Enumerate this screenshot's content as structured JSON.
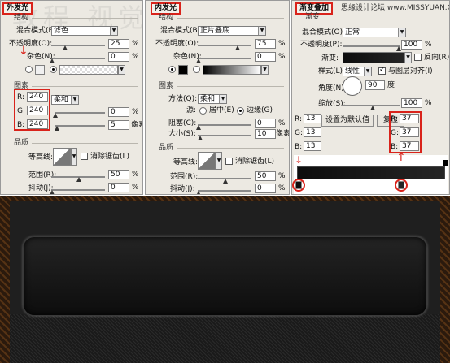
{
  "outer_glow": {
    "title": "外发光",
    "structure": "结构",
    "blend_mode_label": "混合模式(E):",
    "blend_mode": "滤色",
    "opacity_label": "不透明度(O):",
    "opacity": "25",
    "noise_label": "杂色(N):",
    "noise": "0",
    "pct": "%",
    "elements": "图素",
    "technique": "柔和",
    "r_label": "R:",
    "r": "240",
    "g_label": "G:",
    "g": "240",
    "b_label": "B:",
    "b": "240",
    "spread": "0",
    "size": "5",
    "px": "像素",
    "quality": "品质",
    "contour_label": "等高线:",
    "anti_alias": "消除锯齿(L)",
    "range_label": "范围(R):",
    "range": "50",
    "jitter_label": "抖动(J):",
    "jitter": "0"
  },
  "inner_glow": {
    "title": "内发光",
    "structure": "结构",
    "blend_mode_label": "混合模式(B):",
    "blend_mode": "正片叠底",
    "opacity_label": "不透明度(O):",
    "opacity": "75",
    "noise_label": "杂色(N):",
    "noise": "0",
    "pct": "%",
    "elements": "图素",
    "technique_label": "方法(Q):",
    "technique": "柔和",
    "source_label": "源:",
    "center": "居中(E)",
    "edge": "边缘(G)",
    "choke_label": "阻塞(C):",
    "choke": "0",
    "size_label": "大小(S):",
    "size": "10",
    "px": "像素",
    "quality": "品质",
    "contour_label": "等高线:",
    "anti_alias": "消除锯齿(L)",
    "range_label": "范围(R):",
    "range": "50",
    "jitter_label": "抖动(J):",
    "jitter": "0"
  },
  "gradient_overlay": {
    "title": "渐变叠加",
    "subtitle": "渐变",
    "blend_mode_label": "混合模式(O):",
    "blend_mode": "正常",
    "opacity_label": "不透明度(P):",
    "opacity": "100",
    "pct": "%",
    "gradient_label": "渐变:",
    "reverse": "反向(R)",
    "style_label": "样式(L):",
    "style": "线性",
    "align": "与图层对齐(I)",
    "angle_label": "角度(N):",
    "angle": "90",
    "deg": "度",
    "scale_label": "缩放(S):",
    "scale": "100",
    "set_default": "设置为默认值",
    "reset": "复位",
    "left_stop": {
      "r_label": "R:",
      "r": "13",
      "g_label": "G:",
      "g": "13",
      "b_label": "B:",
      "b": "13"
    },
    "right_stop": {
      "r_label": "R:",
      "r": "37",
      "g_label": "G:",
      "g": "37",
      "b_label": "B:",
      "b": "37"
    }
  },
  "site_watermark": "思缘设计论坛 www.MISSYUAN.COM",
  "bg_watermark": "教程 视觉 WWW.TAENET",
  "colors": {
    "accent_red": "#d9231b",
    "frame_brown": "#2b1a0d",
    "panel_bg": "#1f1f1f",
    "screen_bg": "#0d0d0d"
  }
}
